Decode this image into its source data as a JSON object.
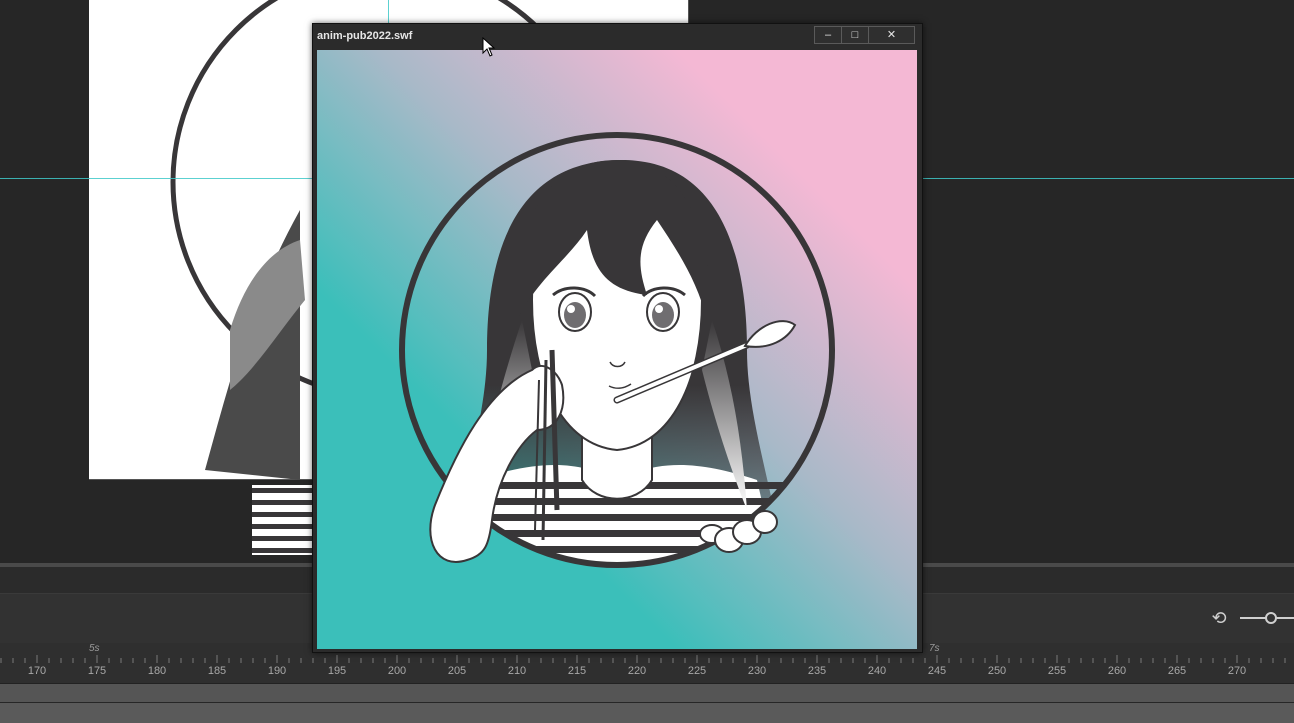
{
  "player_window": {
    "title": "anim-pub2022.swf",
    "minimize_glyph": "–",
    "maximize_glyph": "□",
    "close_glyph": "✕"
  },
  "colors": {
    "stage_bg": "#262626",
    "canvas_bg": "#ffffff",
    "guide": "#3fc9c9",
    "gradient_teal": "#3bbfba",
    "gradient_pink": "#f4b8d4",
    "art_dark": "#383638"
  },
  "icons": {
    "undo": "undo-icon",
    "zoom": "zoom-slider-icon",
    "cursor": "mouse-pointer-icon"
  },
  "timeline": {
    "second_markers": [
      {
        "label": "5s",
        "frame": 175
      },
      {
        "label": "7s",
        "frame": 245
      }
    ],
    "frame_labels": [
      "170",
      "175",
      "180",
      "185",
      "190",
      "195",
      "200",
      "205",
      "210",
      "215",
      "220",
      "225",
      "230",
      "235",
      "240",
      "245",
      "250",
      "255",
      "260",
      "265",
      "270"
    ]
  }
}
